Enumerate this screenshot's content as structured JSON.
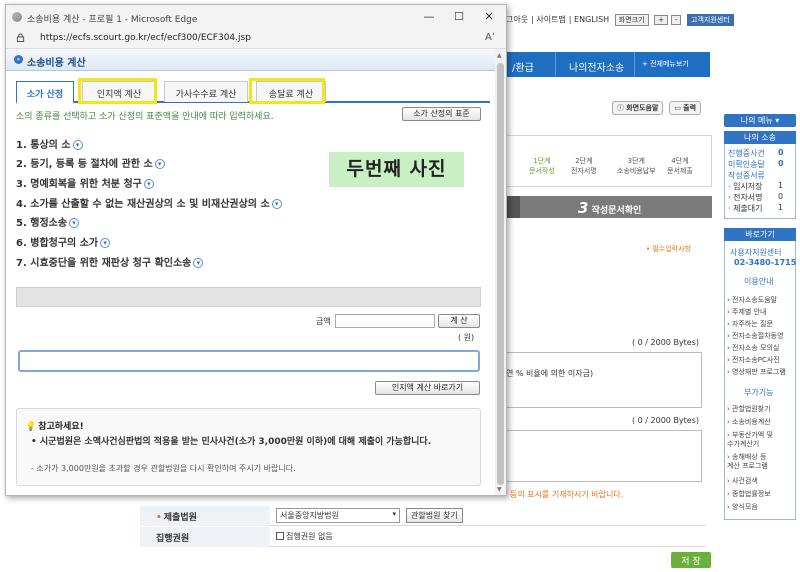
{
  "background": {
    "utility": {
      "logout": "그아웃",
      "sitemap": "사이트맵",
      "english": "ENGLISH",
      "zoom_label": "화면크기",
      "help_center": "고객지원센터"
    },
    "gnb": {
      "item1": "/환급",
      "item2": "나의전자소송",
      "item3": "+ 전체메뉴보기"
    },
    "toolbar": {
      "help": "화면도움말",
      "print": "출력"
    },
    "steps": [
      {
        "label": "1단계\n문서작성"
      },
      {
        "label": "2단계\n전자서명"
      },
      {
        "label": "3단계\n소송비용납부"
      },
      {
        "label": "4단계\n문서제출"
      }
    ],
    "step_banner": {
      "number": "3",
      "label": "작성문서확인"
    },
    "required_note": "• 필수입력사항",
    "bytes1": "( 0 / 2000 Bytes)",
    "bytes2": "( 0 / 2000 Bytes)",
    "ta1_text": "연  % 비율에 의한 이자금)",
    "orange_note": "등의 표시를 기재하시기 바랍니다.",
    "court_label": "제출법원",
    "court_value": "서울중앙지방법원",
    "court_find": "관할법원 찾기",
    "exec_label": "집행권원",
    "exec_value": "집행권원 없음",
    "submit": "저 장"
  },
  "sidebar": {
    "my_menu": "나의 메뉴",
    "my_suit_title": "나의 소송",
    "suit_items": [
      {
        "label": "진행중사건",
        "count": "0"
      },
      {
        "label": "미확인송달",
        "count": "0"
      },
      {
        "label": "작성중서류",
        "count": ""
      },
      {
        "label": "· 임시저장",
        "count": "1"
      },
      {
        "label": "· 전자서명",
        "count": "0"
      },
      {
        "label": "· 제출대기",
        "count": "1"
      }
    ],
    "shortcut_title": "바로가기",
    "center_name": "사용자지원센터",
    "center_tel": "02-3480-1715",
    "guide_title": "이용안내",
    "guide_links": [
      "전자소송도움말",
      "주제별 안내",
      "자주하는 질문",
      "전자소송절차동영",
      "전자소송 모의실",
      "전자소송PC사진",
      "영상재판 프로그램"
    ],
    "related_title": "부가기능",
    "related_links": [
      "관할법원찾기",
      "소송비용계산",
      "부동산가액 및\n수가계산기",
      "송해배상 등\n계산 프로그램",
      "사건검색",
      "종합법률정보",
      "양식모음"
    ]
  },
  "popup": {
    "window_title": "소송비용 계산 - 프로필 1 - Microsoft Edge",
    "url": "https://ecfs.scourt.go.kr/ecf/ecf300/ECF304.jsp",
    "header": "소송비용 계산",
    "tabs": [
      "소가 산정",
      "인지액 계산",
      "가사수수료 계산",
      "송달료 계산"
    ],
    "instruction": "소의 종류를 선택하고 소가 산정의 표준액을 안내에 따라 입력하세요.",
    "standard_button": "소가 산정의 표준",
    "categories": [
      "1. 통상의 소",
      "2. 등기, 등록 등 절차에 관한 소",
      "3. 명예회복을 위한 처분 청구",
      "4. 소가를 산출할 수 없는 재산권상의 소 및 비재산권상의 소",
      "5. 행정소송",
      "6. 병합청구의 소가",
      "7. 시효중단을 위한 재판상 청구 확인소송"
    ],
    "amount_label": "금액",
    "calc_button": "계 산",
    "unit": "( 원)",
    "stamp_link_button": "인지액 계산 바로가기",
    "notice_title": "참고하세요!",
    "notice_line1": "• 시군법원은 소액사건심판법의 적용을 받는 민사사건(소가 3,000만원 이하)에 대해 제출이 가능합니다.",
    "notice_line2": "- 소가가 3,000만원을 초과할 경우 관할법원을 다시 확인하여 주시기 바랍니다."
  },
  "overlay_label": "두번째 사진",
  "colors": {
    "accent": "#2f73c2",
    "highlight": "#f4e51a",
    "overlay_bg": "#c9efc4",
    "submit": "#6bb03c"
  }
}
